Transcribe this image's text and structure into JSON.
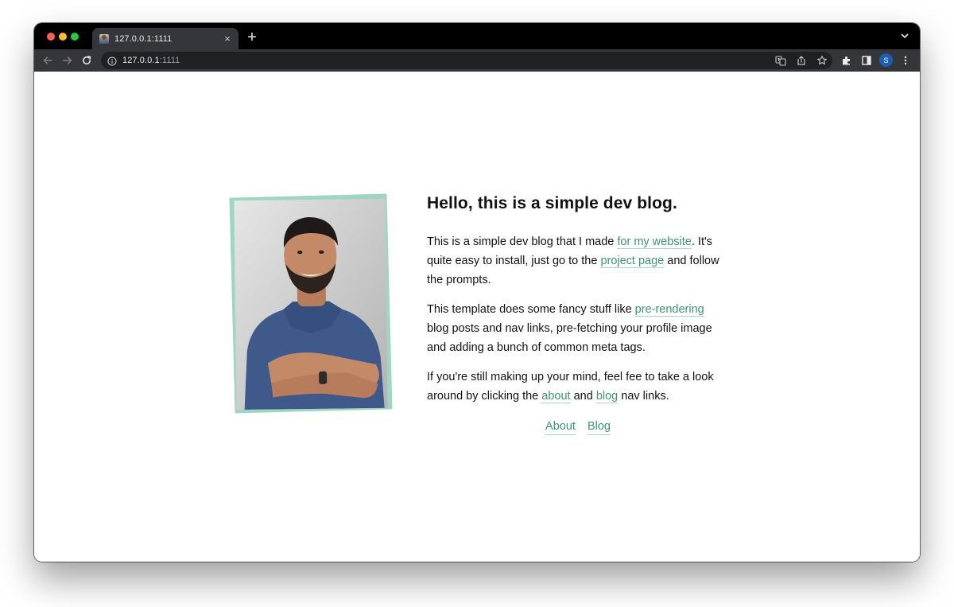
{
  "browser": {
    "tab_title": "127.0.0.1:1111",
    "close_glyph": "×",
    "new_tab_glyph": "+",
    "url_host": "127.0.0.1",
    "url_port": ":1111",
    "profile_initial": "S"
  },
  "hero": {
    "heading": "Hello, this is a simple dev blog.",
    "p1_a": "This is a simple dev blog that I made ",
    "p1_link1": "for my website",
    "p1_b": ". It's quite easy to install, just go to the ",
    "p1_link2": "project page",
    "p1_c": " and follow the prompts.",
    "p2_a": "This template does some fancy stuff like ",
    "p2_link": "pre-rendering",
    "p2_b": " blog posts and nav links, pre-fetching your profile image and adding a bunch of common meta tags.",
    "p3_a": "If you're still making up your mind, feel fee to take a look around by clicking the ",
    "p3_link1": "about",
    "p3_b": " and ",
    "p3_link2": "blog",
    "p3_c": " nav links.",
    "nav": {
      "about": "About",
      "blog": "Blog"
    }
  },
  "colors": {
    "accent_link": "#3f9377",
    "frame_mint": "#9fd6c1",
    "chrome_dark": "#35363a"
  },
  "icons": [
    "back-arrow-icon",
    "forward-arrow-icon",
    "reload-icon",
    "info-icon",
    "translate-icon",
    "share-icon",
    "star-icon",
    "extensions-icon",
    "side-panel-icon",
    "kebab-menu-icon",
    "tab-list-chevron-icon"
  ]
}
